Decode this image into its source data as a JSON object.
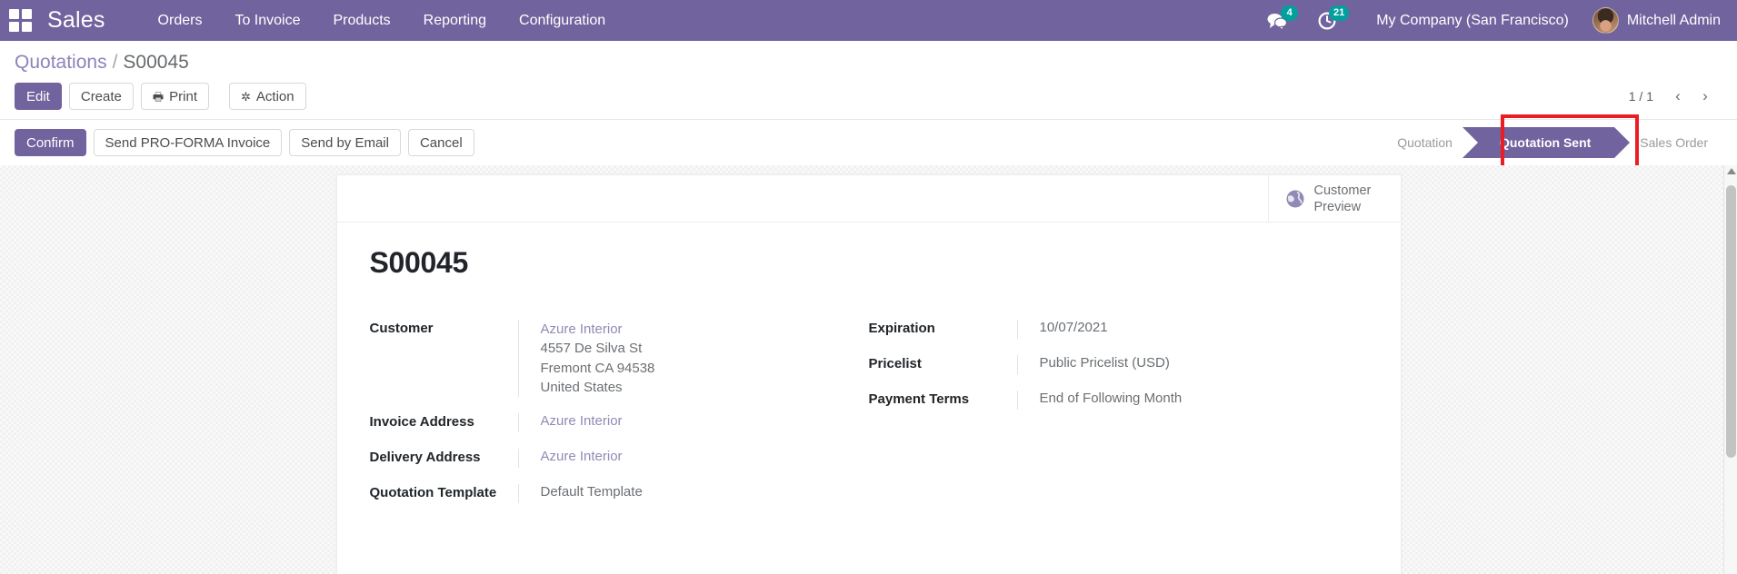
{
  "navbar": {
    "apps_icon": "apps-grid-icon",
    "brand": "Sales",
    "menu": [
      {
        "label": "Orders"
      },
      {
        "label": "To Invoice"
      },
      {
        "label": "Products"
      },
      {
        "label": "Reporting"
      },
      {
        "label": "Configuration"
      }
    ],
    "messages": {
      "icon": "chat-bubbles-icon",
      "count": "4"
    },
    "activities": {
      "icon": "clock-activity-icon",
      "count": "21"
    },
    "company": "My Company (San Francisco)",
    "user": "Mitchell Admin",
    "avatar_icon": "user-avatar",
    "background_color": "#71639e",
    "badge_color": "#00a09d"
  },
  "breadcrumb": {
    "root": "Quotations",
    "separator": "/",
    "current": "S00045"
  },
  "toolbar": {
    "edit_label": "Edit",
    "create_label": "Create",
    "print_label": "Print",
    "print_icon": "printer-icon",
    "action_label": "Action",
    "action_icon": "gear-icon"
  },
  "pager": {
    "value": "1 / 1",
    "prev_icon": "chevron-left-icon",
    "next_icon": "chevron-right-icon"
  },
  "statusbar": {
    "buttons": [
      {
        "label": "Confirm",
        "primary": true
      },
      {
        "label": "Send PRO-FORMA Invoice",
        "primary": false
      },
      {
        "label": "Send by Email",
        "primary": false
      },
      {
        "label": "Cancel",
        "primary": false
      }
    ],
    "stages": [
      {
        "label": "Quotation",
        "active": false
      },
      {
        "label": "Quotation Sent",
        "active": true
      },
      {
        "label": "Sales Order",
        "active": false
      }
    ],
    "highlight_color": "#ec1c24",
    "active_color": "#71639e"
  },
  "sheet": {
    "customer_preview": {
      "label_line1": "Customer",
      "label_line2": "Preview",
      "icon": "globe-icon"
    },
    "record_title": "S00045",
    "left_fields": [
      {
        "label": "Customer",
        "values": [
          {
            "text": "Azure Interior",
            "style": "link"
          },
          {
            "text": "4557 De Silva St",
            "style": "addr"
          },
          {
            "text": "Fremont CA 94538",
            "style": "addr"
          },
          {
            "text": "United States",
            "style": "addr"
          }
        ]
      },
      {
        "label": "Invoice Address",
        "values": [
          {
            "text": "Azure Interior",
            "style": "link"
          }
        ]
      },
      {
        "label": "Delivery Address",
        "values": [
          {
            "text": "Azure Interior",
            "style": "link"
          }
        ]
      },
      {
        "label": "Quotation Template",
        "values": [
          {
            "text": "Default Template",
            "style": "plain"
          }
        ]
      }
    ],
    "right_fields": [
      {
        "label": "Expiration",
        "values": [
          {
            "text": "10/07/2021",
            "style": "plain"
          }
        ]
      },
      {
        "label": "Pricelist",
        "values": [
          {
            "text": "Public Pricelist (USD)",
            "style": "plain"
          }
        ]
      },
      {
        "label": "Payment Terms",
        "values": [
          {
            "text": "End of Following Month",
            "style": "plain"
          }
        ]
      }
    ]
  }
}
